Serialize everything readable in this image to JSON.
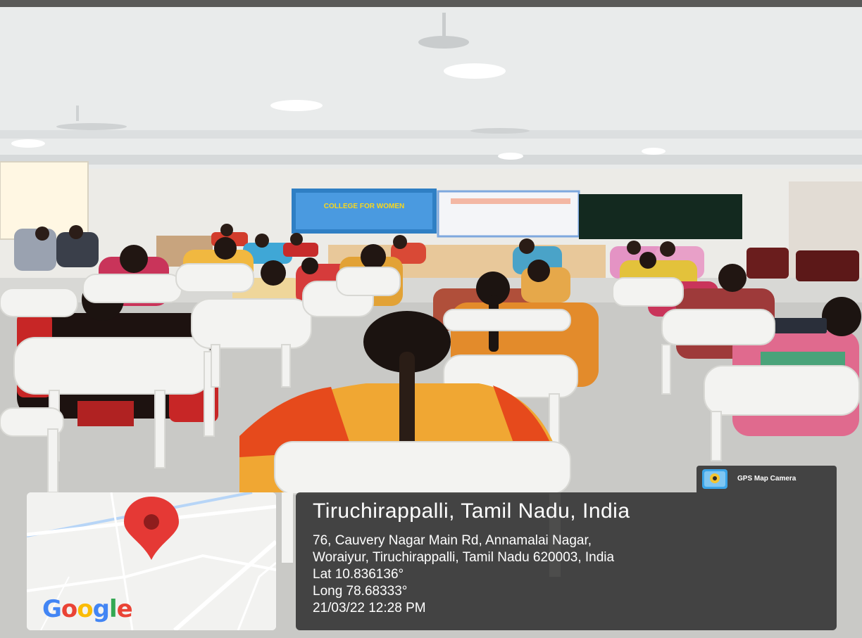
{
  "photo": {
    "banner_text": "COLLEGE FOR WOMEN"
  },
  "map": {
    "brand": "Google",
    "brand_letters": [
      {
        "ch": "G",
        "color": "#4285F4"
      },
      {
        "ch": "o",
        "color": "#EA4335"
      },
      {
        "ch": "o",
        "color": "#FBBC05"
      },
      {
        "ch": "g",
        "color": "#4285F4"
      },
      {
        "ch": "l",
        "color": "#34A853"
      },
      {
        "ch": "e",
        "color": "#EA4335"
      }
    ],
    "pin_color": "#E53935",
    "icon": "map-pin-icon"
  },
  "app": {
    "name": "GPS Map Camera",
    "icon": "gps-map-camera-icon"
  },
  "location": {
    "place": "Tiruchirappalli, Tamil Nadu, India",
    "address_line1": "76, Cauvery Nagar Main Rd, Annamalai Nagar,",
    "address_line2": "Woraiyur, Tiruchirappalli, Tamil Nadu 620003, India",
    "lat": "Lat 10.836136°",
    "long": "Long 78.68333°",
    "datetime": "21/03/22 12:28 PM"
  },
  "colors": {
    "panel_bg": "#1e1e1e",
    "wall": "#ecebe7",
    "floor": "#c9c9c6",
    "chair": "#f3f3f1"
  }
}
